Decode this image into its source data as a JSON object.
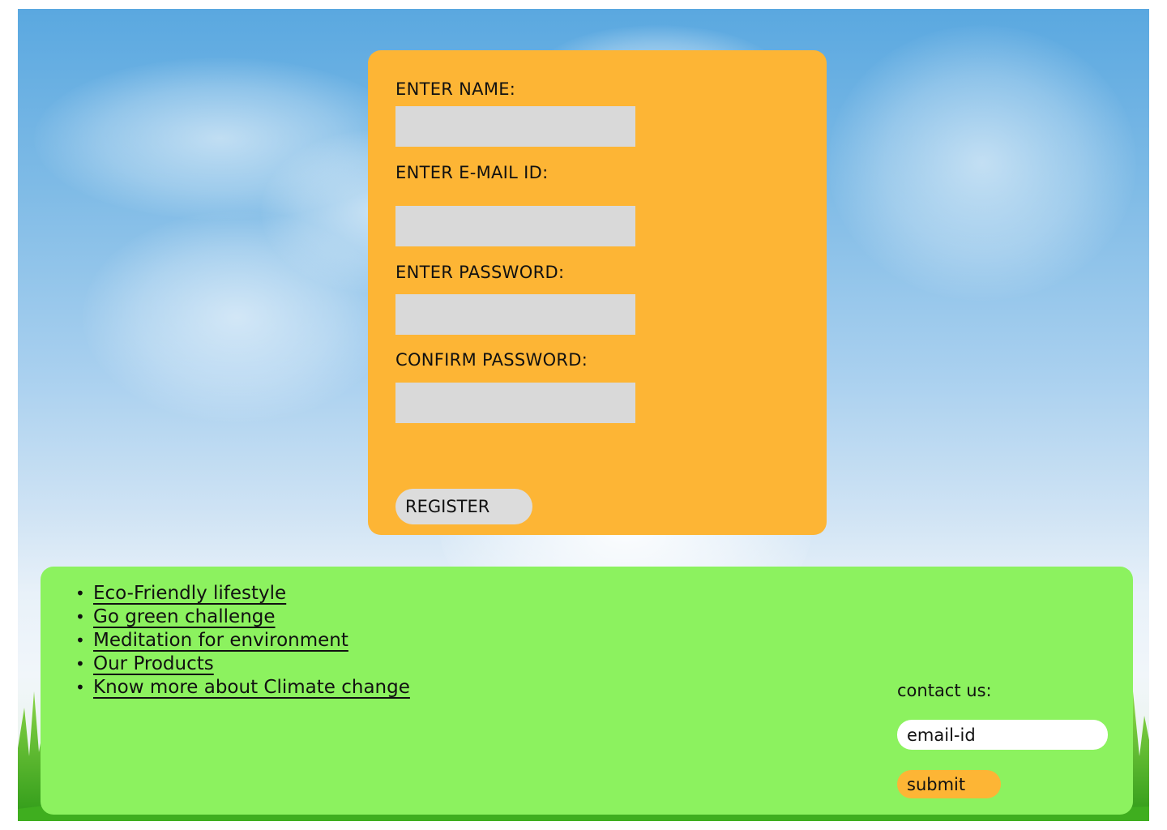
{
  "register_form": {
    "name_label": "ENTER NAME:",
    "email_label": "ENTER E-MAIL ID:",
    "password_label": "ENTER PASSWORD:",
    "confirm_label": "CONFIRM PASSWORD:",
    "name_value": "",
    "email_value": "",
    "password_value": "",
    "confirm_value": "",
    "register_label": "REGISTER"
  },
  "footer": {
    "links": [
      "Eco-Friendly lifestyle",
      "Go green challenge",
      "Meditation for environment",
      "Our Products",
      "Know more about Climate change"
    ],
    "contact_label": "contact us:",
    "email_placeholder": "email-id",
    "submit_label": "submit"
  },
  "colors": {
    "card": "#fdb535",
    "input": "#d9d9d9",
    "footer": "#8cf25f",
    "sky_top": "#5aa8e0",
    "grass": "#3fae1f"
  }
}
